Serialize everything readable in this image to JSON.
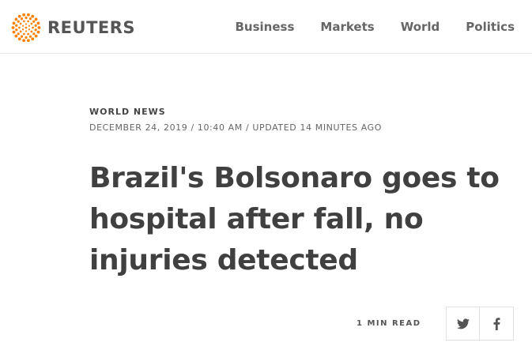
{
  "header": {
    "logo_text": "REUTERS",
    "brand_color": "#ff8000",
    "nav": [
      {
        "label": "Business"
      },
      {
        "label": "Markets"
      },
      {
        "label": "World"
      },
      {
        "label": "Politics"
      }
    ]
  },
  "article": {
    "section": "WORLD NEWS",
    "dateline": "DECEMBER 24, 2019 / 10:40 AM / UPDATED 14 MINUTES AGO",
    "headline": "Brazil's Bolsonaro goes to hospital after fall, no injuries detected",
    "read_time": "1 MIN READ"
  },
  "share": {
    "icons": [
      "twitter-icon",
      "facebook-icon"
    ]
  }
}
